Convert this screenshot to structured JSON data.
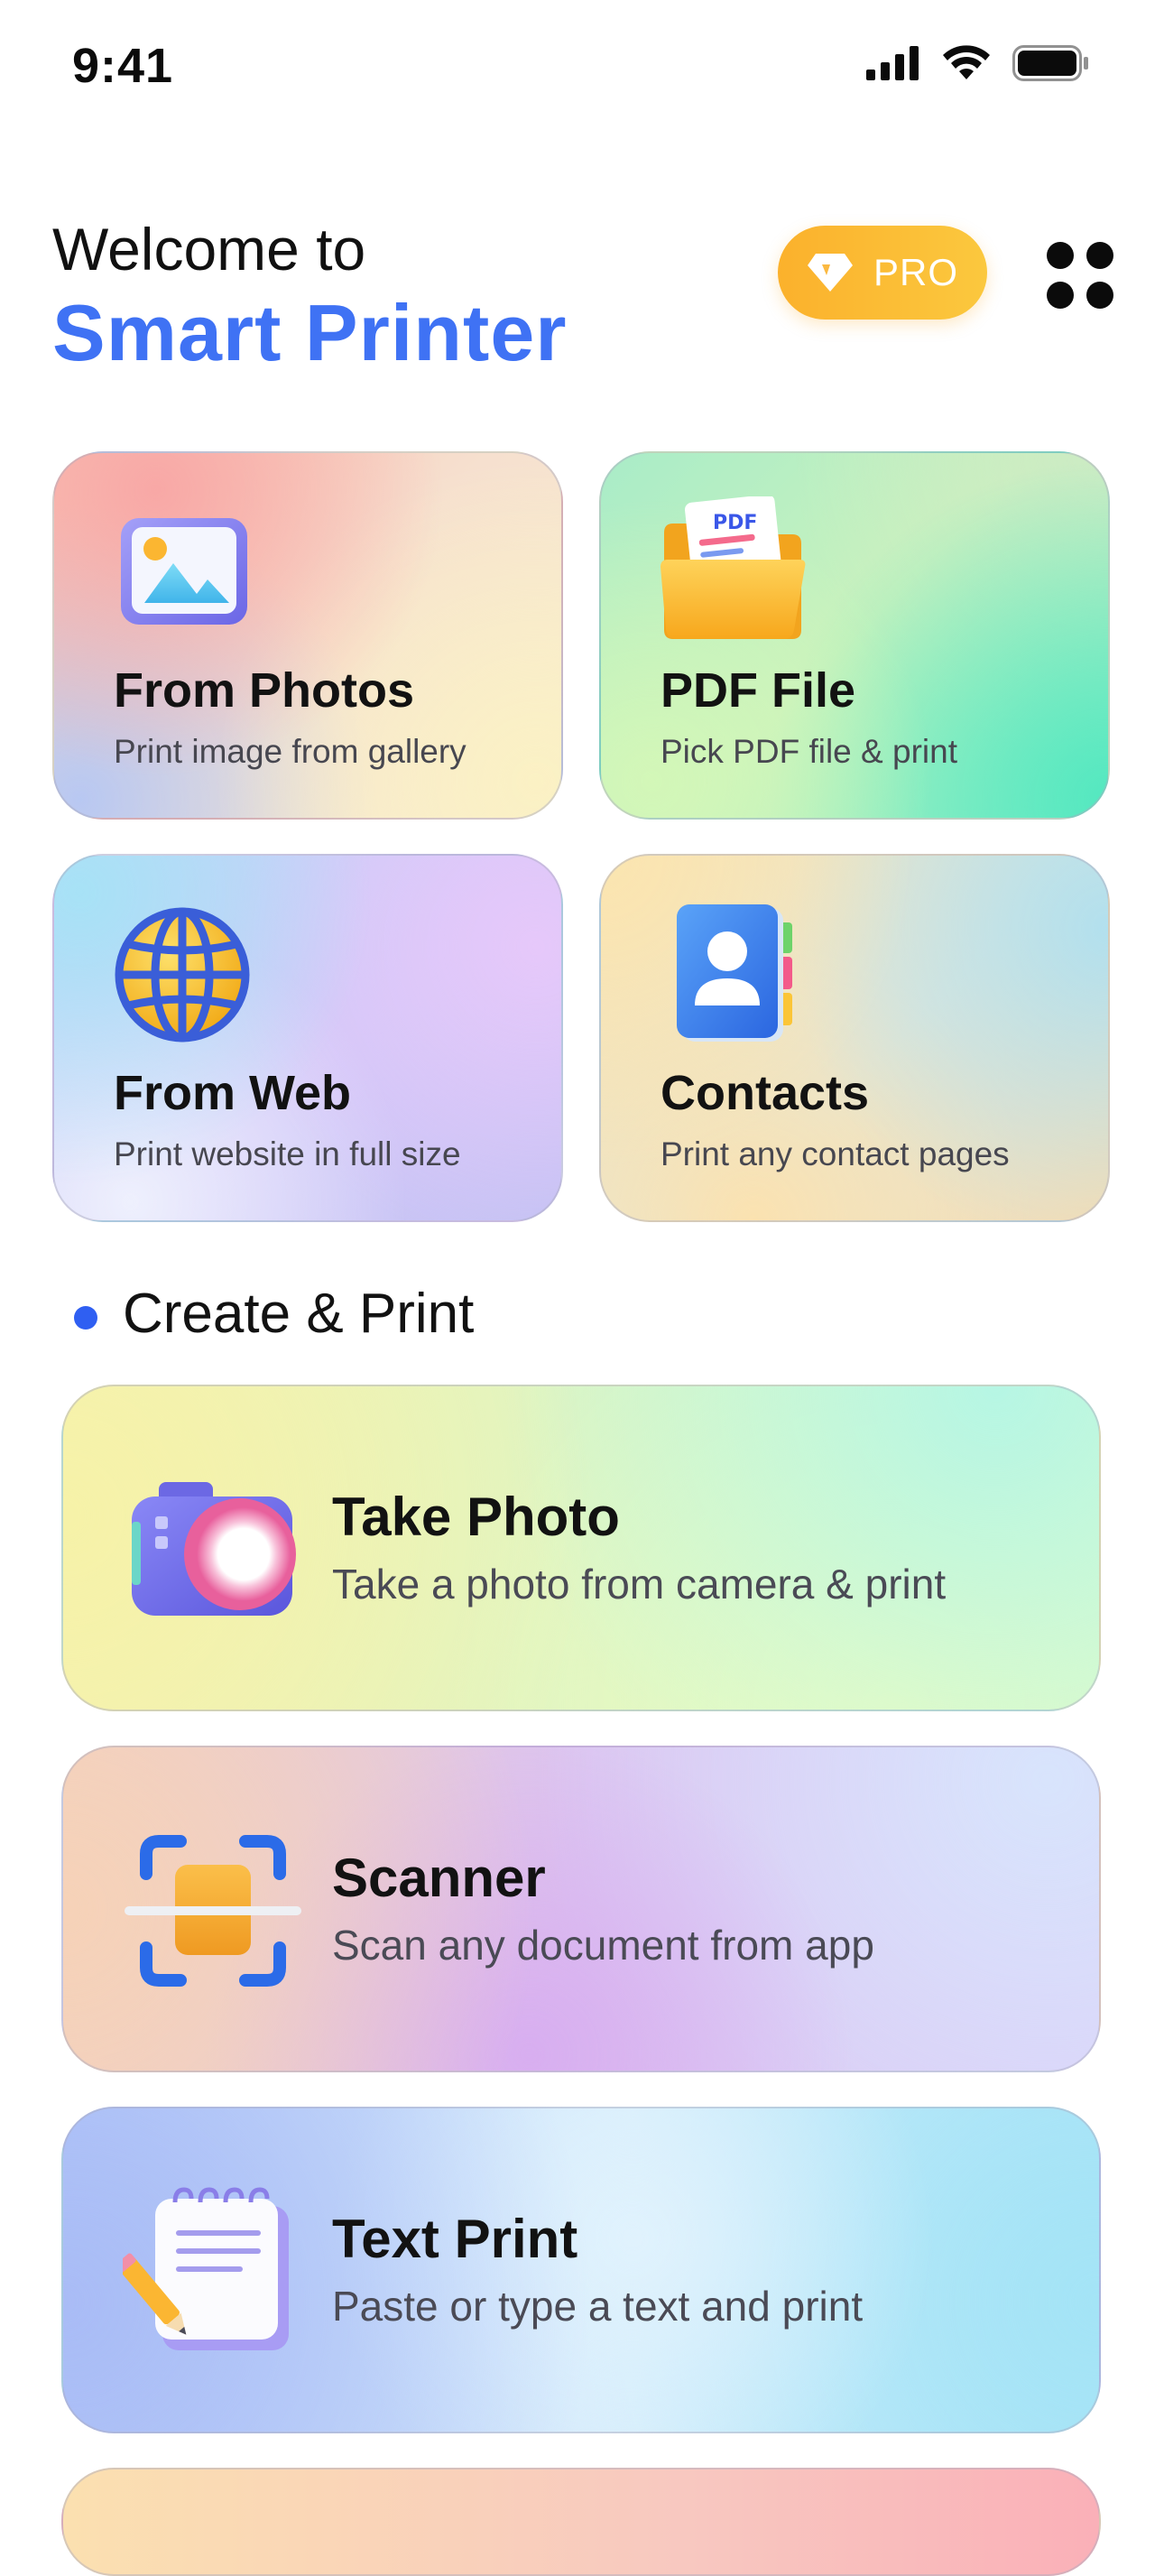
{
  "status_bar": {
    "time": "9:41"
  },
  "header": {
    "welcome": "Welcome to",
    "brand": "Smart Printer",
    "pro_label": "PRO"
  },
  "tiles": [
    {
      "title": "From Photos",
      "subtitle": "Print image from gallery",
      "icon": "gallery-icon"
    },
    {
      "title": "PDF File",
      "subtitle": "Pick PDF file & print",
      "icon": "pdf-folder-icon",
      "icon_text": "PDF"
    },
    {
      "title": "From Web",
      "subtitle": "Print website in full size",
      "icon": "globe-icon"
    },
    {
      "title": "Contacts",
      "subtitle": "Print any contact pages",
      "icon": "contact-book-icon"
    }
  ],
  "section": {
    "title": "Create & Print"
  },
  "actions": [
    {
      "title": "Take Photo",
      "subtitle": "Take a photo from camera & print",
      "icon": "camera-icon"
    },
    {
      "title": "Scanner",
      "subtitle": "Scan any document from app",
      "icon": "scanner-icon"
    },
    {
      "title": "Text Print",
      "subtitle": "Paste or type a text and print",
      "icon": "notepad-icon"
    }
  ],
  "colors": {
    "accent": "#3f72f4",
    "pro": "#fbb12c",
    "section_dot": "#2f5ff2"
  }
}
